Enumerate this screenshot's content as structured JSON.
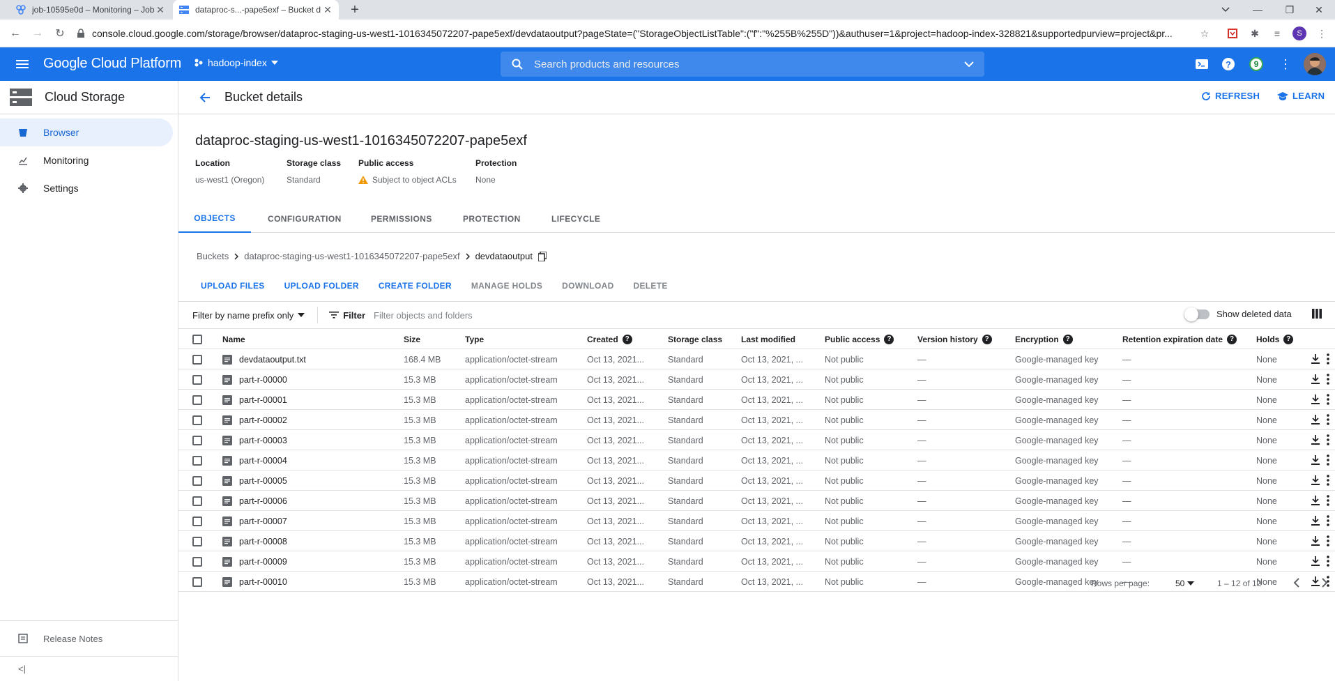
{
  "browser": {
    "tabs": [
      {
        "title": "job-10595e0d – Monitoring – Job"
      },
      {
        "title": "dataproc-s...-pape5exf – Bucket d"
      }
    ],
    "url": "console.cloud.google.com/storage/browser/dataproc-staging-us-west1-1016345072207-pape5exf/devdataoutput?pageState=(\"StorageObjectListTable\":(\"f\":\"%255B%255D\"))&authuser=1&project=hadoop-index-328821&supportedpurview=project&pr...",
    "profile_initial": "S"
  },
  "header": {
    "brand": "Google Cloud Platform",
    "project": "hadoop-index",
    "search_placeholder": "Search products and resources",
    "notification_count": "9"
  },
  "sidebar": {
    "title": "Cloud Storage",
    "items": [
      {
        "label": "Browser"
      },
      {
        "label": "Monitoring"
      },
      {
        "label": "Settings"
      }
    ],
    "release_notes": "Release Notes"
  },
  "page": {
    "title": "Bucket details",
    "refresh": "REFRESH",
    "learn": "LEARN",
    "bucket_name": "dataproc-staging-us-west1-1016345072207-pape5exf",
    "props": [
      {
        "label": "Location",
        "value": "us-west1 (Oregon)"
      },
      {
        "label": "Storage class",
        "value": "Standard"
      },
      {
        "label": "Public access",
        "value": "Subject to object ACLs"
      },
      {
        "label": "Protection",
        "value": "None"
      }
    ],
    "tabs": [
      "OBJECTS",
      "CONFIGURATION",
      "PERMISSIONS",
      "PROTECTION",
      "LIFECYCLE"
    ],
    "breadcrumb": [
      "Buckets",
      "dataproc-staging-us-west1-1016345072207-pape5exf",
      "devdataoutput"
    ],
    "actions": [
      "UPLOAD FILES",
      "UPLOAD FOLDER",
      "CREATE FOLDER",
      "MANAGE HOLDS",
      "DOWNLOAD",
      "DELETE"
    ],
    "filter_prefix": "Filter by name prefix only",
    "filter_label": "Filter",
    "filter_placeholder": "Filter objects and folders",
    "show_deleted": "Show deleted data"
  },
  "table": {
    "columns": [
      "Name",
      "Size",
      "Type",
      "Created",
      "Storage class",
      "Last modified",
      "Public access",
      "Version history",
      "Encryption",
      "Retention expiration date",
      "Holds"
    ],
    "rows": [
      [
        "devdataoutput.txt",
        "168.4 MB",
        "application/octet-stream",
        "Oct 13, 2021...",
        "Standard",
        "Oct 13, 2021, ...",
        "Not public",
        "—",
        "Google-managed key",
        "—",
        "None"
      ],
      [
        "part-r-00000",
        "15.3 MB",
        "application/octet-stream",
        "Oct 13, 2021...",
        "Standard",
        "Oct 13, 2021, ...",
        "Not public",
        "—",
        "Google-managed key",
        "—",
        "None"
      ],
      [
        "part-r-00001",
        "15.3 MB",
        "application/octet-stream",
        "Oct 13, 2021...",
        "Standard",
        "Oct 13, 2021, ...",
        "Not public",
        "—",
        "Google-managed key",
        "—",
        "None"
      ],
      [
        "part-r-00002",
        "15.3 MB",
        "application/octet-stream",
        "Oct 13, 2021...",
        "Standard",
        "Oct 13, 2021, ...",
        "Not public",
        "—",
        "Google-managed key",
        "—",
        "None"
      ],
      [
        "part-r-00003",
        "15.3 MB",
        "application/octet-stream",
        "Oct 13, 2021...",
        "Standard",
        "Oct 13, 2021, ...",
        "Not public",
        "—",
        "Google-managed key",
        "—",
        "None"
      ],
      [
        "part-r-00004",
        "15.3 MB",
        "application/octet-stream",
        "Oct 13, 2021...",
        "Standard",
        "Oct 13, 2021, ...",
        "Not public",
        "—",
        "Google-managed key",
        "—",
        "None"
      ],
      [
        "part-r-00005",
        "15.3 MB",
        "application/octet-stream",
        "Oct 13, 2021...",
        "Standard",
        "Oct 13, 2021, ...",
        "Not public",
        "—",
        "Google-managed key",
        "—",
        "None"
      ],
      [
        "part-r-00006",
        "15.3 MB",
        "application/octet-stream",
        "Oct 13, 2021...",
        "Standard",
        "Oct 13, 2021, ...",
        "Not public",
        "—",
        "Google-managed key",
        "—",
        "None"
      ],
      [
        "part-r-00007",
        "15.3 MB",
        "application/octet-stream",
        "Oct 13, 2021...",
        "Standard",
        "Oct 13, 2021, ...",
        "Not public",
        "—",
        "Google-managed key",
        "—",
        "None"
      ],
      [
        "part-r-00008",
        "15.3 MB",
        "application/octet-stream",
        "Oct 13, 2021...",
        "Standard",
        "Oct 13, 2021, ...",
        "Not public",
        "—",
        "Google-managed key",
        "—",
        "None"
      ],
      [
        "part-r-00009",
        "15.3 MB",
        "application/octet-stream",
        "Oct 13, 2021...",
        "Standard",
        "Oct 13, 2021, ...",
        "Not public",
        "—",
        "Google-managed key",
        "—",
        "None"
      ],
      [
        "part-r-00010",
        "15.3 MB",
        "application/octet-stream",
        "Oct 13, 2021...",
        "Standard",
        "Oct 13, 2021, ...",
        "Not public",
        "—",
        "Google-managed key",
        "—",
        "None"
      ]
    ]
  },
  "pager": {
    "rows_per_page_label": "Rows per page:",
    "rows_per_page": "50",
    "range": "1 – 12 of 12"
  },
  "colors": {
    "accent": "#1a73e8",
    "warning": "#f29900"
  }
}
